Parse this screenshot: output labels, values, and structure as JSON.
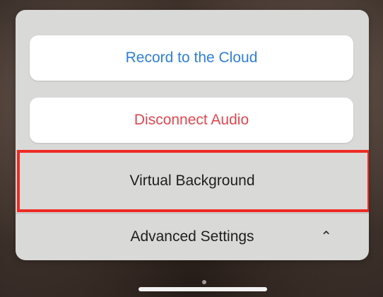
{
  "menu": {
    "record_label": "Record to the Cloud",
    "disconnect_label": "Disconnect Audio",
    "virtual_background_label": "Virtual Background",
    "advanced_settings_label": "Advanced Settings",
    "advanced_chevron_icon": "chevron-up-icon"
  },
  "colors": {
    "record_text": "#2f7fd8",
    "disconnect_text": "#e0474f",
    "highlight_border": "#ee2a24",
    "sheet_background": "#d9d9d7"
  },
  "highlight": {
    "target": "Virtual Background"
  }
}
